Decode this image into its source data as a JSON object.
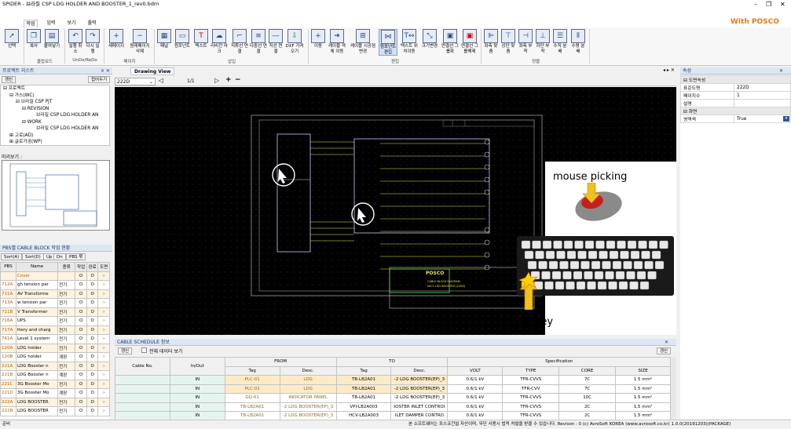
{
  "window": {
    "title": "SPIDER - 브라질 CSP LDG HOLDER AND BOOSTER_1_rev0.bdm",
    "brand": "With POSCO"
  },
  "tabs": [
    "작업",
    "입력",
    "보기",
    "출력"
  ],
  "ribbon": {
    "buttons": [
      "선택",
      "복사",
      "붙여넣기",
      "실행 취소",
      "다시 실행",
      "새페이지",
      "원재페이지 삭제",
      "패널",
      "컴포넌트",
      "텍스트",
      "리비전 마크",
      "직류선 연결",
      "다중선 연결",
      "직선 연결",
      "DXF 가져오기",
      "이동",
      "케이블 객체 이동",
      "케이블 시공점 변경",
      "컴포넌트 편집",
      "텍스트 위치이동",
      "크기변경",
      "연결선 그룹화",
      "연결선 그룹해제",
      "좌측 맞춤",
      "상단 맞춤",
      "좌측 부착",
      "하단 부착",
      "수직 분배",
      "수평 분배"
    ],
    "groups": [
      "클립보드",
      "UnDo/ReDo",
      "페이지",
      "삽입",
      "편집",
      "정렬"
    ]
  },
  "project": {
    "title": "프로젝트 리스트",
    "expand": "갱신",
    "collapse": "접어두기",
    "tree": [
      "프로젝트",
      "가스(WC)",
      "브라질 CSP PJT",
      "REVISION",
      "브라질 CSP LDG HOLDER AN",
      "WORK",
      "브라질 CSP LDG HOLDER AN",
      "고로(AD)",
      "글로가공(WP)"
    ],
    "preview": "미리보기 :"
  },
  "pbs": {
    "title": "PBS별 CABLE BLOCK 작업 현황",
    "buttons": [
      "Sort(A)",
      "Sort(D)",
      "Up",
      "Dn",
      "PBS 묶"
    ],
    "columns": [
      "PBS",
      "Name",
      "종류",
      "작업",
      "완료",
      "도면"
    ],
    "rows": [
      [
        "",
        "Cover",
        "",
        "O",
        "O",
        "›"
      ],
      [
        "712A",
        "gh tension par",
        "전기",
        "O",
        "O",
        "›"
      ],
      [
        "711A",
        "AV Transforme",
        "전기",
        "O",
        "O",
        "›"
      ],
      [
        "713A",
        "w tension par",
        "전기",
        "O",
        "O",
        "›"
      ],
      [
        "711B",
        "V Transformer",
        "전기",
        "O",
        "O",
        "›"
      ],
      [
        "716A",
        "UPS",
        "전기",
        "O",
        "O",
        "›"
      ],
      [
        "717A",
        "ttery and charg",
        "전기",
        "O",
        "O",
        "›"
      ],
      [
        "761A",
        "Level 1 system",
        "전기",
        "O",
        "O",
        "›"
      ],
      [
        "120A",
        "LDG holder",
        "전기",
        "O",
        "O",
        "›"
      ],
      [
        "120B",
        "LDG holder",
        "계장",
        "O",
        "O",
        "›"
      ],
      [
        "221A",
        "LDG Booster n",
        "전기",
        "O",
        "O",
        "›"
      ],
      [
        "221B",
        "LDG Booster n",
        "계장",
        "O",
        "O",
        "›"
      ],
      [
        "221C",
        "3G Booster Mo",
        "전기",
        "O",
        "O",
        "›"
      ],
      [
        "221D",
        "3G Booster Mo",
        "계장",
        "O",
        "O",
        "›"
      ],
      [
        "222A",
        "LDG BOOSTER",
        "전기",
        "O",
        "O",
        "›"
      ],
      [
        "222B",
        "LDG BOOSTER",
        "전기",
        "O",
        "O",
        "›"
      ]
    ]
  },
  "drawing": {
    "tab": "Drawing View",
    "page_select": "222D",
    "page": "1/1",
    "title_company": "POSCO",
    "diagram_title": "CABLE BLOCK DIAGRAM",
    "diagram_sub": "NO.2 LDG BOOSTER (222D)",
    "annotation_mouse": "mouse picking",
    "annotation_key": "Ctrl key"
  },
  "schedule": {
    "title": "CABLE SCHEDULE 정보",
    "btn_apply": "갱신",
    "checkbox": "전체 데이터 보기",
    "btn_refresh": "갱신",
    "headers": {
      "cable": "Cable No.",
      "inout": "In/Out",
      "from": "FROM",
      "to": "TO",
      "spec": "Specification",
      "tag": "Tag",
      "desc": "Desc.",
      "volt": "VOLT",
      "type": "TYPE",
      "core": "CORE",
      "size": "SIZE"
    },
    "rows": [
      [
        "IN",
        "PLC-01",
        "LDG",
        "TB-LB2A01",
        "-2 LDG BOOSTER(EP)_3",
        "0.6/1 kV",
        "TFR-CVVS",
        "7C",
        "1.5 mm²"
      ],
      [
        "IN",
        "PLC-01",
        "LDG",
        "TB-LB2A01",
        "-2 LDG BOOSTER(EP)_3",
        "0.6/1 kV",
        "TFR-CVV",
        "7C",
        "1.5 mm²"
      ],
      [
        "IN",
        "GD-01",
        "INDICATOR PANEL",
        "TB-LB2A01",
        "-2 LDG BOOSTER(EP)_3",
        "0.6/1 kV",
        "TFR-CVVS",
        "10C",
        "1.5 mm²"
      ],
      [
        "IN",
        "TB-LB2A01",
        "-2 LDG BOOSTER(EP)_3",
        "VPI-LB2A003",
        "IOSTER INLET CONTROI",
        "0.6/1 kV",
        "TFR-CVVS",
        "2C",
        "1.5 mm²"
      ],
      [
        "IN",
        "TB-LB2A01",
        "-2 LDG BOOSTER(EP)_3",
        "HCV-LB2A003",
        "ILET DAMPER CONTRO",
        "0.6/1 kV",
        "TFR-CVVS",
        "2C",
        "1.5 mm²"
      ]
    ]
  },
  "props": {
    "title": "속성",
    "section1": "도면속성",
    "rows1": [
      [
        "표준도명",
        "222D"
      ],
      [
        "페이지수",
        "1"
      ],
      [
        "설명",
        ""
      ]
    ],
    "section2": "화면",
    "rows2": [
      [
        "영역색",
        "True"
      ]
    ]
  },
  "status": {
    "left": "준비",
    "right": "본 소프트웨어는 포스코건설 자산이며, 무단 사용시 법적 처벌을 받을 수 있습니다. Revison : 0   (c) AvroSoft KOREA (www.avrosoft.co.kr)   1.0.0(20191203)(PACKAGE)"
  },
  "colors": {
    "accent": "#2b5797",
    "canvas": "#000000",
    "highlight_row": "#fdebc8"
  }
}
